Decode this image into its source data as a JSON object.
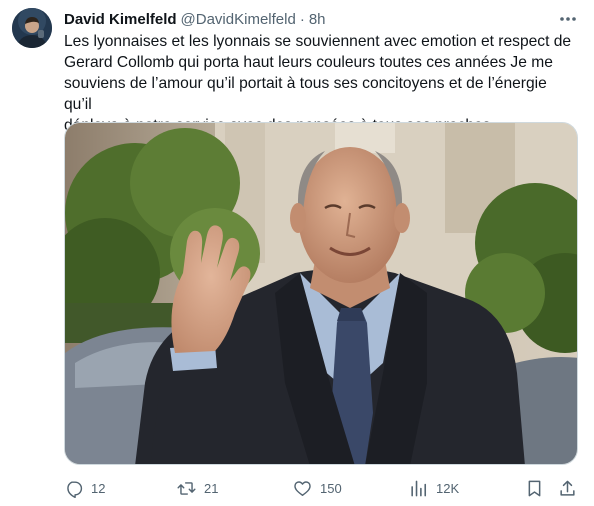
{
  "tweet": {
    "author": {
      "display_name": "David Kimelfeld",
      "handle": "@DavidKimelfeld",
      "avatar_icon": "profile-photo"
    },
    "separator": "·",
    "timestamp": "8h",
    "more_icon": "more-horizontal-icon",
    "text": "Les lyonnaises et les lyonnais se souviennent avec emotion et respect de\nGerard Collomb qui porta haut leurs couleurs toutes ces années Je me\nsouviens de l’amour qu’il portait à tous ses concitoyens et de l’énergie qu’il\ndéploya à notre service avec des pensées à tous ses proches",
    "media": {
      "type": "photo"
    },
    "actions": {
      "replies": {
        "icon": "reply-icon",
        "count": "12"
      },
      "retweets": {
        "icon": "retweet-icon",
        "count": "21"
      },
      "likes": {
        "icon": "heart-icon",
        "count": "150"
      },
      "views": {
        "icon": "views-chart-icon",
        "count": "12K"
      },
      "bookmark": {
        "icon": "bookmark-icon"
      },
      "share": {
        "icon": "share-icon"
      }
    },
    "colors": {
      "text_primary": "#0f1419",
      "text_secondary": "#536471",
      "border": "#cfd9de",
      "background": "#ffffff"
    }
  }
}
